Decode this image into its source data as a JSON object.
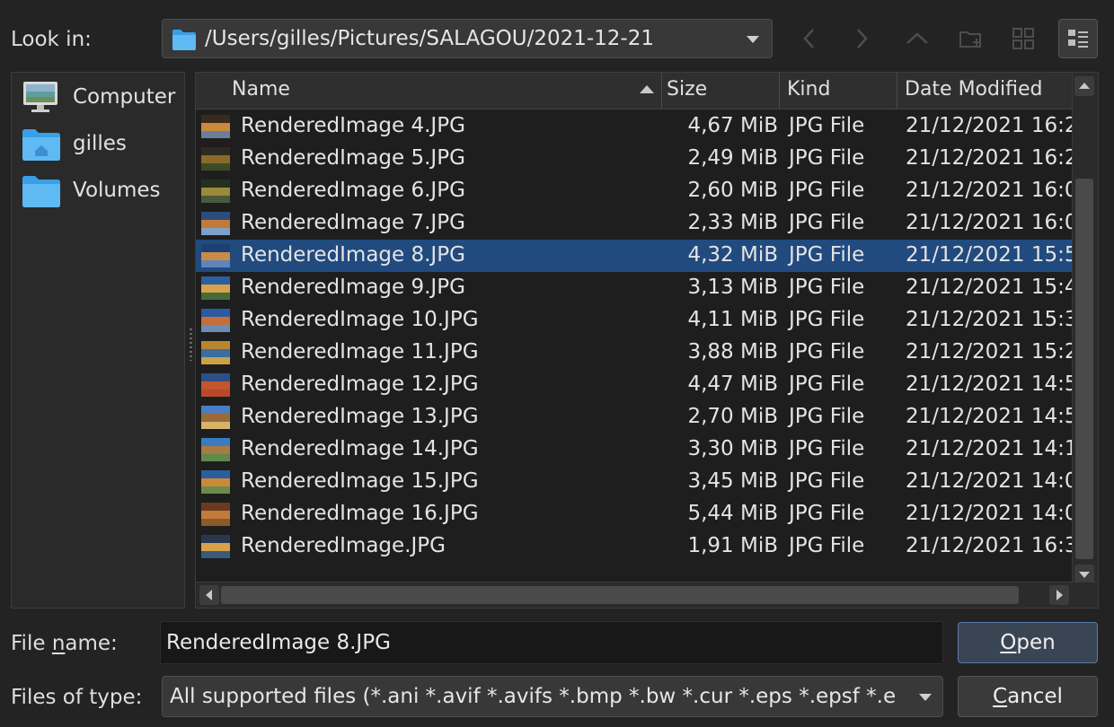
{
  "look_in": {
    "label": "Look in:",
    "path": "/Users/gilles/Pictures/SALAGOU/2021-12-21"
  },
  "toolbar": {
    "icons": [
      "back-icon",
      "forward-icon",
      "parent-folder-icon",
      "new-folder-icon",
      "list-view-icon",
      "detail-view-icon"
    ]
  },
  "sidebar": {
    "items": [
      {
        "label": "Computer",
        "icon": "computer-icon"
      },
      {
        "label": "gilles",
        "icon": "home-folder-icon"
      },
      {
        "label": "Volumes",
        "icon": "folder-icon"
      }
    ]
  },
  "columns": {
    "name": "Name",
    "size": "Size",
    "kind": "Kind",
    "date": "Date Modified"
  },
  "files": [
    {
      "name": "RenderedImage 4.JPG",
      "size": "4,67 MiB",
      "kind": "JPG File",
      "date": "21/12/2021 16:2"
    },
    {
      "name": "RenderedImage 5.JPG",
      "size": "2,49 MiB",
      "kind": "JPG File",
      "date": "21/12/2021 16:2"
    },
    {
      "name": "RenderedImage 6.JPG",
      "size": "2,60 MiB",
      "kind": "JPG File",
      "date": "21/12/2021 16:0"
    },
    {
      "name": "RenderedImage 7.JPG",
      "size": "2,33 MiB",
      "kind": "JPG File",
      "date": "21/12/2021 16:0"
    },
    {
      "name": "RenderedImage 8.JPG",
      "size": "4,32 MiB",
      "kind": "JPG File",
      "date": "21/12/2021 15:5",
      "selected": true
    },
    {
      "name": "RenderedImage 9.JPG",
      "size": "3,13 MiB",
      "kind": "JPG File",
      "date": "21/12/2021 15:4"
    },
    {
      "name": "RenderedImage 10.JPG",
      "size": "4,11 MiB",
      "kind": "JPG File",
      "date": "21/12/2021 15:3"
    },
    {
      "name": "RenderedImage 11.JPG",
      "size": "3,88 MiB",
      "kind": "JPG File",
      "date": "21/12/2021 15:2"
    },
    {
      "name": "RenderedImage 12.JPG",
      "size": "4,47 MiB",
      "kind": "JPG File",
      "date": "21/12/2021 14:5"
    },
    {
      "name": "RenderedImage 13.JPG",
      "size": "2,70 MiB",
      "kind": "JPG File",
      "date": "21/12/2021 14:5"
    },
    {
      "name": "RenderedImage 14.JPG",
      "size": "3,30 MiB",
      "kind": "JPG File",
      "date": "21/12/2021 14:1"
    },
    {
      "name": "RenderedImage 15.JPG",
      "size": "3,45 MiB",
      "kind": "JPG File",
      "date": "21/12/2021 14:0"
    },
    {
      "name": "RenderedImage 16.JPG",
      "size": "5,44 MiB",
      "kind": "JPG File",
      "date": "21/12/2021 14:0"
    },
    {
      "name": "RenderedImage.JPG",
      "size": "1,91 MiB",
      "kind": "JPG File",
      "date": "21/12/2021 16:3"
    }
  ],
  "file_name": {
    "label_pre": "File ",
    "label_mnemonic": "n",
    "label_post": "ame:",
    "value": "RenderedImage 8.JPG"
  },
  "file_type": {
    "label": "Files of type:",
    "value": "All supported files (*.ani *.avif *.avifs *.bmp *.bw *.cur *.eps *.epsf *.e"
  },
  "buttons": {
    "open_mnemonic": "O",
    "open_rest": "pen",
    "cancel_mnemonic": "C",
    "cancel_rest": "ancel"
  },
  "colors": {
    "selection": "#214a7f",
    "folder_blue": "#3aa0e6"
  }
}
